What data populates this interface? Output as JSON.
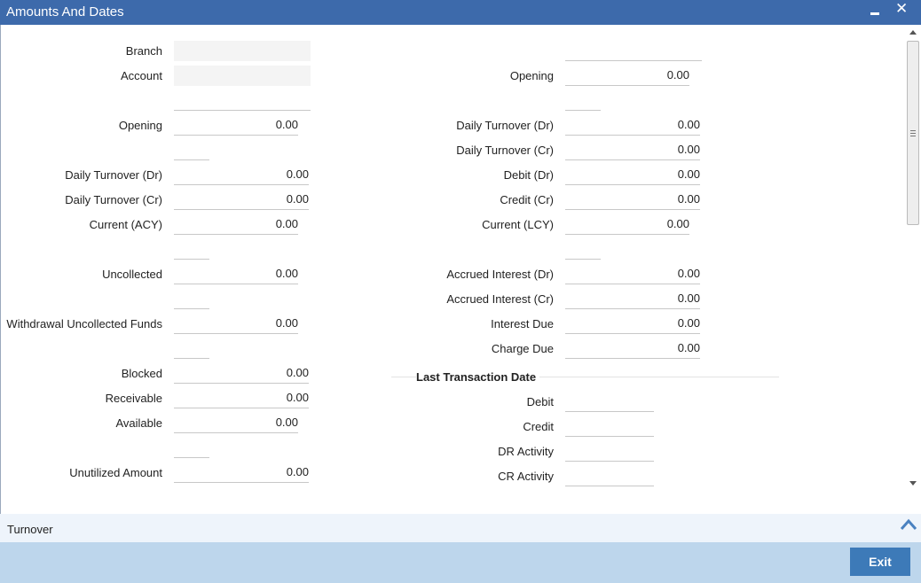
{
  "window": {
    "title": "Amounts And Dates"
  },
  "left": {
    "branch_label": "Branch",
    "account_label": "Account",
    "opening_label": "Opening",
    "opening_value": "0.00",
    "daily_dr_label": "Daily Turnover (Dr)",
    "daily_dr_value": "0.00",
    "daily_cr_label": "Daily Turnover (Cr)",
    "daily_cr_value": "0.00",
    "current_acy_label": "Current (ACY)",
    "current_acy_value": "0.00",
    "uncollected_label": "Uncollected",
    "uncollected_value": "0.00",
    "withdrawal_label": "Withdrawal Uncollected Funds",
    "withdrawal_value": "0.00",
    "blocked_label": "Blocked",
    "blocked_value": "0.00",
    "receivable_label": "Receivable",
    "receivable_value": "0.00",
    "available_label": "Available",
    "available_value": "0.00",
    "unutilized_label": "Unutilized Amount",
    "unutilized_value": "0.00"
  },
  "right": {
    "opening_label": "Opening",
    "opening_value": "0.00",
    "daily_dr_label": "Daily Turnover (Dr)",
    "daily_dr_value": "0.00",
    "daily_cr_label": "Daily Turnover (Cr)",
    "daily_cr_value": "0.00",
    "debit_dr_label": "Debit (Dr)",
    "debit_dr_value": "0.00",
    "credit_cr_label": "Credit (Cr)",
    "credit_cr_value": "0.00",
    "current_lcy_label": "Current (LCY)",
    "current_lcy_value": "0.00",
    "accrued_dr_label": "Accrued Interest (Dr)",
    "accrued_dr_value": "0.00",
    "accrued_cr_label": "Accrued Interest (Cr)",
    "accrued_cr_value": "0.00",
    "interest_due_label": "Interest Due",
    "interest_due_value": "0.00",
    "charge_due_label": "Charge Due",
    "charge_due_value": "0.00"
  },
  "last_txn": {
    "heading": "Last Transaction Date",
    "debit_label": "Debit",
    "credit_label": "Credit",
    "dr_activity_label": "DR Activity",
    "cr_activity_label": "CR Activity"
  },
  "turnover": {
    "label": "Turnover"
  },
  "footer": {
    "exit_label": "Exit"
  }
}
